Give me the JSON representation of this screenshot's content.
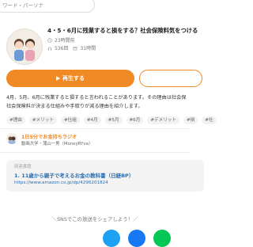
{
  "search": {
    "placeholder": "ワード・パーソナ"
  },
  "episode": {
    "title": "4・5・6月に残業すると損をする？社会保険料気をつける",
    "duration": "23時間前",
    "plays": "536回",
    "date": "31時間"
  },
  "actions": {
    "play_label": "再生する"
  },
  "description": {
    "line1": "4月、5月、6月に残業すると損すると言われることがあります。その理由は社会保",
    "line2": "社会保険料が決まる仕組みや手取りが減る理由を紹介します。"
  },
  "tags": [
    "#理由",
    "#メリット",
    "#仕組",
    "#4月",
    "#5月",
    "#6月",
    "#デメリット",
    "#損",
    "#社"
  ],
  "channel": {
    "name": "1日5分でお金持ちラジオ",
    "hosts": "動画大学・蒲山一男（MoneyRYva）"
  },
  "book": {
    "label": "関連書籍",
    "title": "1. 11歳から親子で考えるお金の教科書（日経BP）",
    "url": "https://www.amazon.co.jp/dp/4296201824"
  },
  "share": {
    "text": "＼SNSでこの放送をシェアしよう！／"
  },
  "colors": {
    "accent": "#f08a24",
    "link": "#2a6fb2",
    "twitter": "#1da1f2",
    "facebook": "#1877f2",
    "line": "#06c755"
  },
  "icons": {
    "search": "search-icon",
    "clock": "clock-icon",
    "headphones": "headphones-icon",
    "calendar": "calendar-icon",
    "play": "play-icon"
  }
}
